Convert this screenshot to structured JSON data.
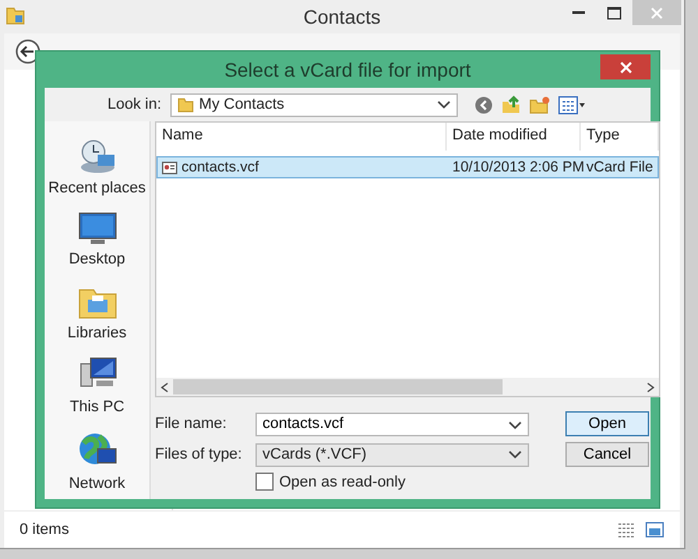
{
  "window": {
    "title": "Contacts",
    "status_bar": {
      "text": "0 items"
    }
  },
  "dialog": {
    "title": "Select a vCard file for import",
    "look_in": {
      "label": "Look in:",
      "value": "My Contacts"
    },
    "places": [
      {
        "label": "Recent places",
        "kind": "recent"
      },
      {
        "label": "Desktop",
        "kind": "desktop"
      },
      {
        "label": "Libraries",
        "kind": "libraries"
      },
      {
        "label": "This PC",
        "kind": "pc"
      },
      {
        "label": "Network",
        "kind": "network"
      }
    ],
    "table": {
      "columns": [
        "Name",
        "Date modified",
        "Type"
      ],
      "rows": [
        {
          "cells": [
            "contacts.vcf",
            "10/10/2013 2:06 PM",
            "vCard File"
          ],
          "selected": true
        }
      ]
    },
    "file_name": {
      "label": "File name:",
      "value": "contacts.vcf"
    },
    "file_type": {
      "label": "Files of type:",
      "value": "vCards (*.VCF)"
    },
    "read_only": {
      "label": "Open as read-only",
      "checked": false
    },
    "buttons": [
      {
        "label": "Open",
        "kind": "primary"
      },
      {
        "label": "Cancel",
        "kind": "normal"
      }
    ]
  }
}
